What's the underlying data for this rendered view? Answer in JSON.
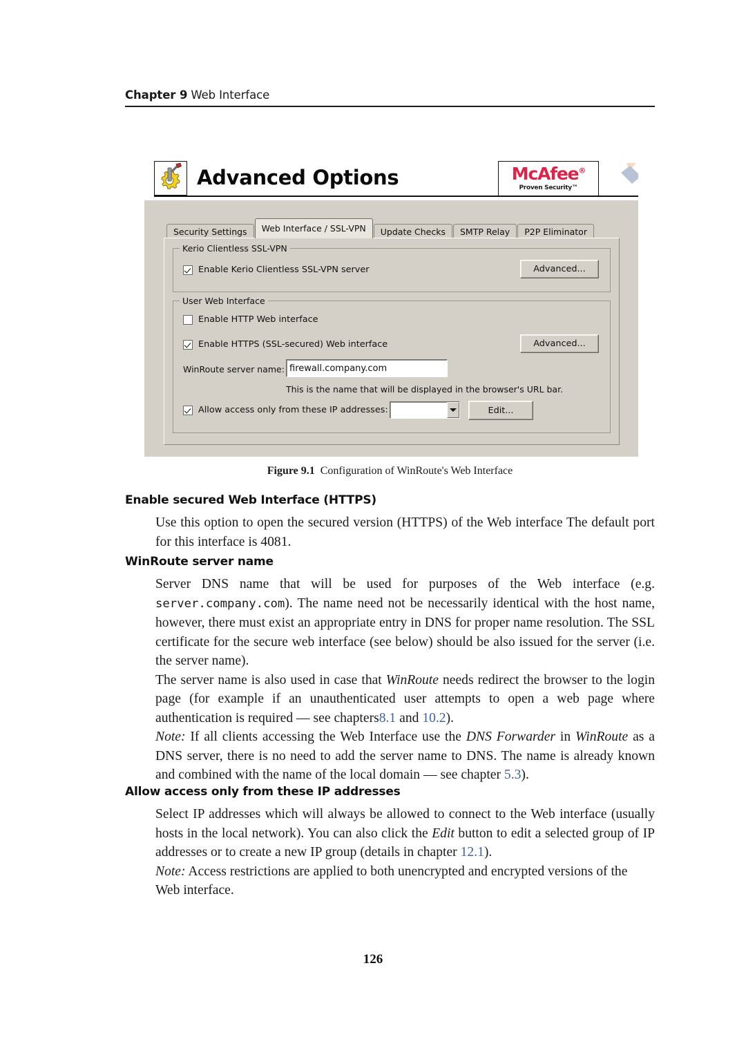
{
  "running_head": {
    "chapter": "Chapter 9",
    "section": "Web Interface"
  },
  "figure": {
    "caption_number": "Figure 9.1",
    "caption_text": "Configuration of WinRoute's Web Interface",
    "dialog": {
      "banner_title": "Advanced Options",
      "banner_icon": "gear-hammer-icon",
      "brand": {
        "name": "McAfee",
        "registered_mark": "®",
        "tagline": "Proven Security™",
        "color": "#d9264b"
      },
      "tabs": [
        {
          "label": "Security Settings",
          "active": false
        },
        {
          "label": "Web Interface / SSL-VPN",
          "active": true
        },
        {
          "label": "Update Checks",
          "active": false
        },
        {
          "label": "SMTP Relay",
          "active": false
        },
        {
          "label": "P2P Eliminator",
          "active": false
        }
      ],
      "groups": [
        {
          "legend": "Kerio Clientless SSL-VPN",
          "checkbox_label": "Enable Kerio Clientless SSL-VPN server",
          "checkbox_checked": true,
          "button_label": "Advanced..."
        },
        {
          "legend": "User Web Interface",
          "http_checkbox_label": "Enable HTTP Web interface",
          "http_checkbox_checked": false,
          "https_checkbox_label": "Enable HTTPS (SSL-secured) Web interface",
          "https_checkbox_checked": true,
          "https_button_label": "Advanced...",
          "server_name_label": "WinRoute server name:",
          "server_name_value": "firewall.company.com",
          "server_name_hint": "This is the name that will be displayed in the browser's URL bar.",
          "allow_checkbox_label": "Allow access only from these IP addresses:",
          "allow_checkbox_checked": true,
          "ip_group_value": "",
          "edit_button_label": "Edit..."
        }
      ]
    }
  },
  "sections": [
    {
      "term": "Enable secured Web Interface (HTTPS)",
      "paragraphs": [
        "Use this option to open the secured version (HTTPS) of the Web interface The default port for this interface is 4081."
      ]
    },
    {
      "term": "WinRoute server name",
      "para1_a": "Server DNS name that will be used for purposes of the Web interface (e.g. ",
      "para1_mono": "server.company.com",
      "para1_b": "). The name need not be necessarily identical with the host name, however, there must exist an appropriate entry in DNS for proper name resolution. The SSL certificate for the secure web interface (see below) should be also issued for the server (i.e. the server name).",
      "para2_a": "The server name is also used in case that ",
      "para2_italic": "WinRoute",
      "para2_b": " needs redirect the browser to the login page (for example if an unauthenticated user attempts to open a web page where authentication is required — see chapters",
      "para2_link1": "8.1",
      "para2_c": " and ",
      "para2_link2": "10.2",
      "para2_d": ").",
      "para3_note": "Note:",
      "para3_a": " If all clients accessing the Web Interface use the ",
      "para3_italic1": "DNS Forwarder",
      "para3_b": " in ",
      "para3_italic2": "WinRoute",
      "para3_c": " as a DNS server, there is no need to add the server name to DNS. The name is already known and combined with the name of the local domain — see chapter ",
      "para3_link": "5.3",
      "para3_d": ")."
    },
    {
      "term": "Allow access only from these IP addresses",
      "para1_a": "Select IP addresses which will always be allowed to connect to the Web interface (usually hosts in the local network).  You can also click the ",
      "para1_italic": "Edit",
      "para1_b": " button to edit a selected group of IP addresses or to create a new IP group (details in chapter ",
      "para1_link": "12.1",
      "para1_c": ").",
      "para2_note": "Note:",
      "para2_a": " Access restrictions are applied to both unencrypted and encrypted versions of the Web interface."
    }
  ],
  "folio": "126"
}
